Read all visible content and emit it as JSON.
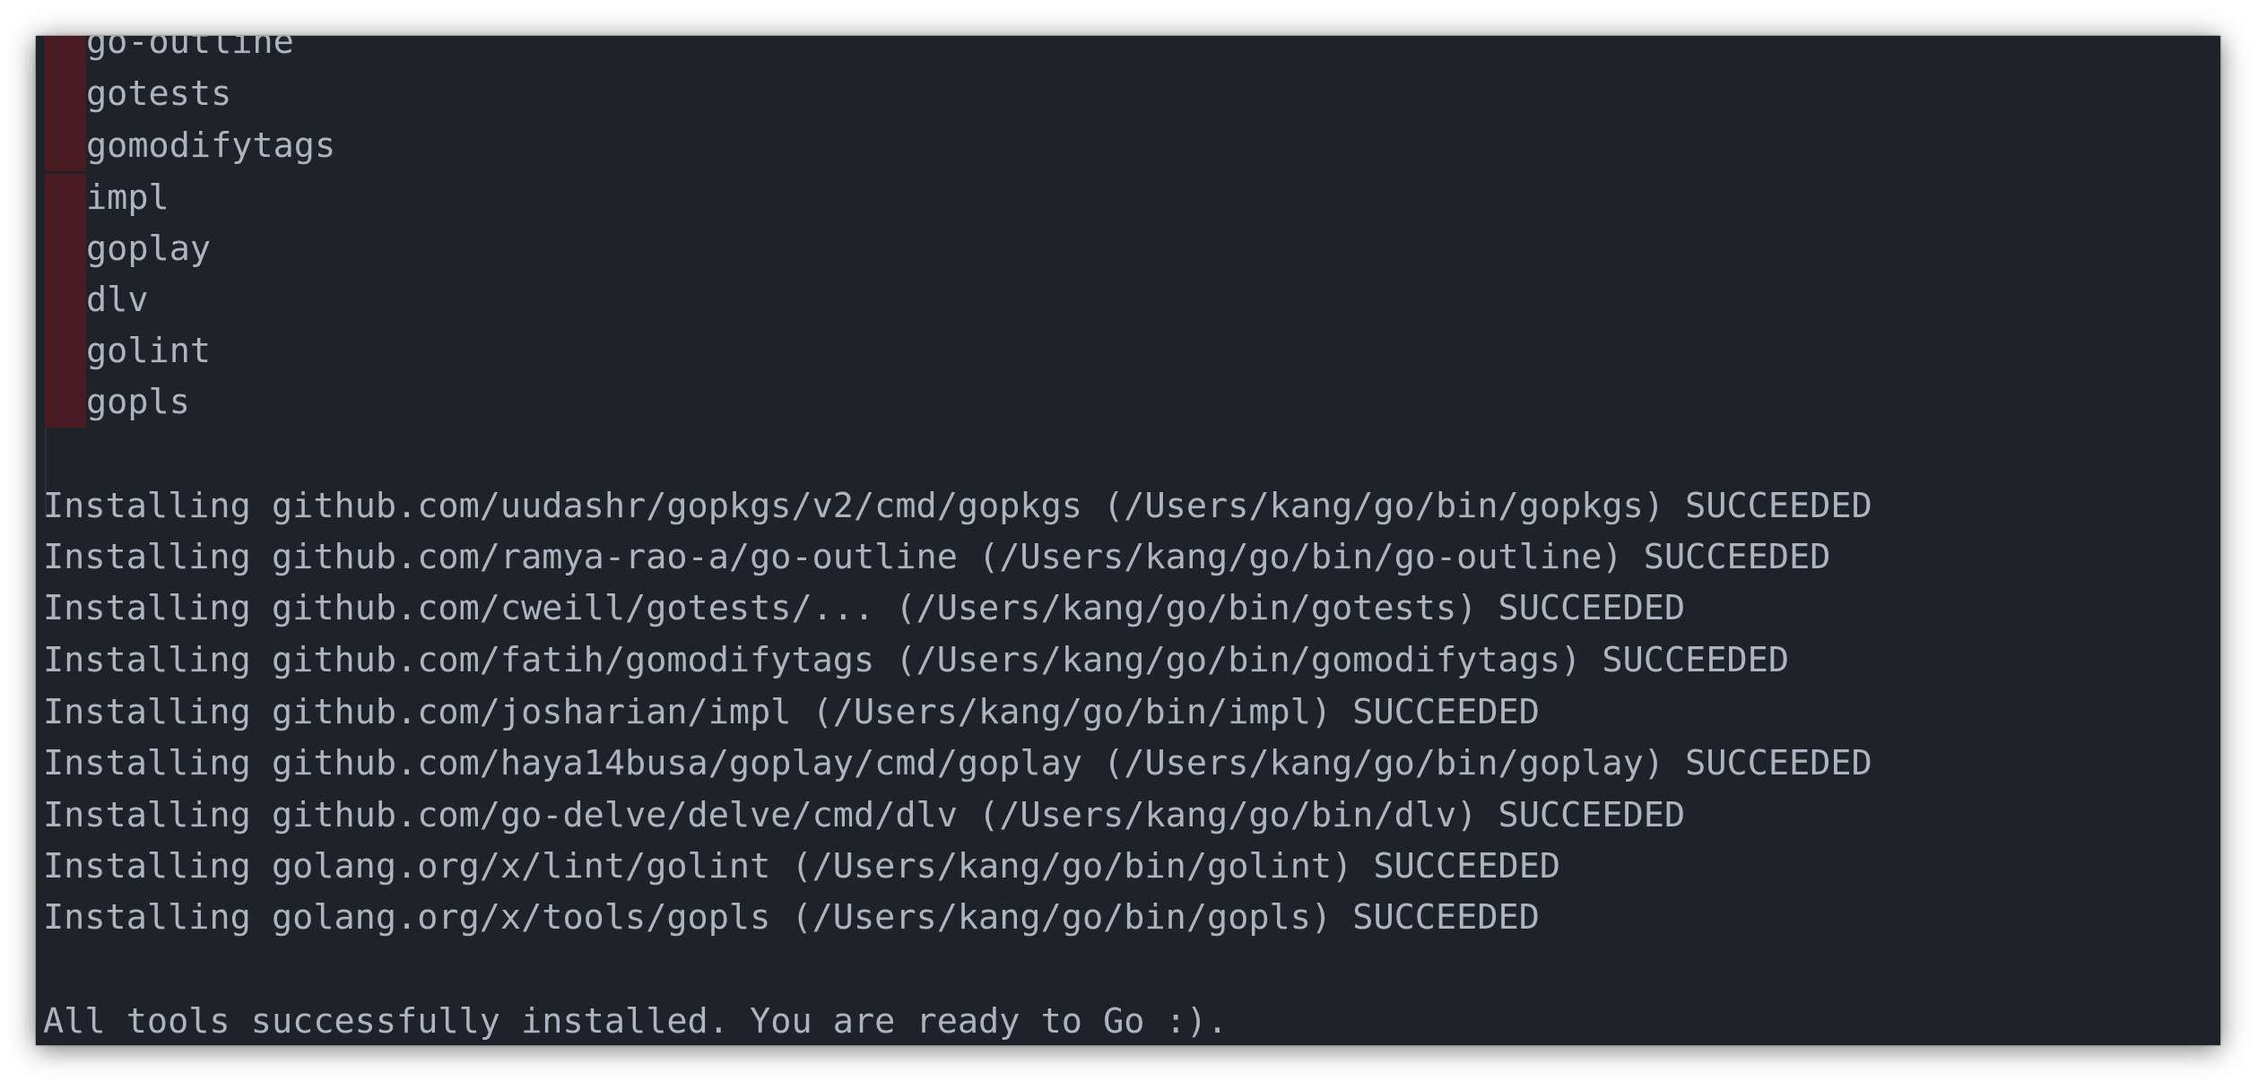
{
  "terminal": {
    "tool_list": [
      "go-outline",
      "gotests",
      "gomodifytags",
      "impl",
      "goplay",
      "dlv",
      "golint",
      "gopls"
    ],
    "install_lines": [
      "Installing github.com/uudashr/gopkgs/v2/cmd/gopkgs (/Users/kang/go/bin/gopkgs) SUCCEEDED",
      "Installing github.com/ramya-rao-a/go-outline (/Users/kang/go/bin/go-outline) SUCCEEDED",
      "Installing github.com/cweill/gotests/... (/Users/kang/go/bin/gotests) SUCCEEDED",
      "Installing github.com/fatih/gomodifytags (/Users/kang/go/bin/gomodifytags) SUCCEEDED",
      "Installing github.com/josharian/impl (/Users/kang/go/bin/impl) SUCCEEDED",
      "Installing github.com/haya14busa/goplay/cmd/goplay (/Users/kang/go/bin/goplay) SUCCEEDED",
      "Installing github.com/go-delve/delve/cmd/dlv (/Users/kang/go/bin/dlv) SUCCEEDED",
      "Installing golang.org/x/lint/golint (/Users/kang/go/bin/golint) SUCCEEDED",
      "Installing golang.org/x/tools/gopls (/Users/kang/go/bin/gopls) SUCCEEDED"
    ],
    "final_message": "All tools successfully installed. You are ready to Go :).",
    "colors": {
      "background": "#1f2229",
      "text": "#aeb4bf",
      "gutter_highlight": "#4a1b22"
    }
  }
}
